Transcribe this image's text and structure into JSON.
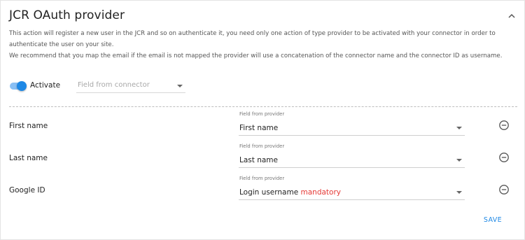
{
  "panel": {
    "title": "JCR OAuth provider",
    "description_line1": "This action will register a new user in the JCR and so on authenticate it, you need only one action of type provider to be activated with your connector in order to",
    "description_line2": "authenticate the user on your site.",
    "description_line3": "We recommend that you map the email if the email is not mapped the provider will use a concatenation of the connector name and the connector ID as username."
  },
  "activate": {
    "label": "Activate",
    "enabled": true,
    "connector_field_placeholder": "Field from connector"
  },
  "mappings": [
    {
      "label": "First name",
      "caption": "Field from provider",
      "value": "First name",
      "mandatory": ""
    },
    {
      "label": "Last name",
      "caption": "Field from provider",
      "value": "Last name",
      "mandatory": ""
    },
    {
      "label": "Google ID",
      "caption": "Field from provider",
      "value": "Login username",
      "mandatory": "mandatory"
    }
  ],
  "actions": {
    "save_label": "SAVE"
  },
  "icons": {
    "collapse": "chevron-up-icon",
    "dropdown": "caret-down-icon",
    "remove": "remove-circle-icon"
  },
  "colors": {
    "accent": "#1e88e5",
    "toggle_track": "#89bff4",
    "mandatory": "#e53935"
  }
}
